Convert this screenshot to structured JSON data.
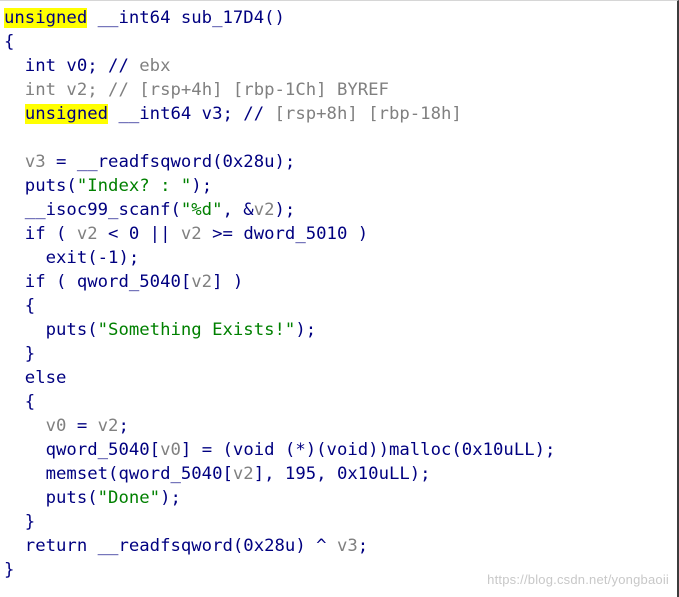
{
  "code_view": {
    "lines": [
      [
        {
          "text": "unsigned",
          "cls": "hl"
        },
        {
          "text": " __int64 sub_17D4()",
          "cls": "c"
        }
      ],
      [
        {
          "text": "{",
          "cls": "c"
        }
      ],
      [
        {
          "text": "  int v0; // ",
          "cls": "c"
        },
        {
          "text": "ebx",
          "cls": "gr"
        }
      ],
      [
        {
          "text": "  int v2; // ",
          "cls": "gr"
        },
        {
          "text": "[rsp+4h] [rbp-1Ch] BYREF",
          "cls": "gr"
        }
      ],
      [
        {
          "text": "  ",
          "cls": "c"
        },
        {
          "text": "unsigned",
          "cls": "hl"
        },
        {
          "text": " __int64 v3; // ",
          "cls": "c"
        },
        {
          "text": "[rsp+8h] [rbp-18h]",
          "cls": "gr"
        }
      ],
      [
        {
          "text": "",
          "cls": "c"
        }
      ],
      [
        {
          "text": "  ",
          "cls": "c"
        },
        {
          "text": "v3",
          "cls": "gr"
        },
        {
          "text": " = __readfsqword(0x28u);",
          "cls": "c"
        }
      ],
      [
        {
          "text": "  puts(",
          "cls": "c"
        },
        {
          "text": "\"Index? : \"",
          "cls": "sg"
        },
        {
          "text": ");",
          "cls": "c"
        }
      ],
      [
        {
          "text": "  __isoc99_scanf(",
          "cls": "c"
        },
        {
          "text": "\"%d\"",
          "cls": "sg"
        },
        {
          "text": ", &",
          "cls": "c"
        },
        {
          "text": "v2",
          "cls": "gr"
        },
        {
          "text": ");",
          "cls": "c"
        }
      ],
      [
        {
          "text": "  if ( ",
          "cls": "c"
        },
        {
          "text": "v2",
          "cls": "gr"
        },
        {
          "text": " < 0 || ",
          "cls": "c"
        },
        {
          "text": "v2",
          "cls": "gr"
        },
        {
          "text": " >= dword_5010 )",
          "cls": "c"
        }
      ],
      [
        {
          "text": "    exit(-1);",
          "cls": "c"
        }
      ],
      [
        {
          "text": "  if ( qword_5040[",
          "cls": "c"
        },
        {
          "text": "v2",
          "cls": "gr"
        },
        {
          "text": "] )",
          "cls": "c"
        }
      ],
      [
        {
          "text": "  {",
          "cls": "c"
        }
      ],
      [
        {
          "text": "    puts(",
          "cls": "c"
        },
        {
          "text": "\"Something Exists!\"",
          "cls": "sg"
        },
        {
          "text": ");",
          "cls": "c"
        }
      ],
      [
        {
          "text": "  }",
          "cls": "c"
        }
      ],
      [
        {
          "text": "  else",
          "cls": "c"
        }
      ],
      [
        {
          "text": "  {",
          "cls": "c"
        }
      ],
      [
        {
          "text": "    ",
          "cls": "c"
        },
        {
          "text": "v0",
          "cls": "gr"
        },
        {
          "text": " = ",
          "cls": "c"
        },
        {
          "text": "v2",
          "cls": "gr"
        },
        {
          "text": ";",
          "cls": "c"
        }
      ],
      [
        {
          "text": "    qword_5040[",
          "cls": "c"
        },
        {
          "text": "v0",
          "cls": "gr"
        },
        {
          "text": "] = (void (*)(void))malloc(0x10uLL);",
          "cls": "c"
        }
      ],
      [
        {
          "text": "    memset(qword_5040[",
          "cls": "c"
        },
        {
          "text": "v2",
          "cls": "gr"
        },
        {
          "text": "], 195, 0x10uLL);",
          "cls": "c"
        }
      ],
      [
        {
          "text": "    puts(",
          "cls": "c"
        },
        {
          "text": "\"Done\"",
          "cls": "sg"
        },
        {
          "text": ");",
          "cls": "c"
        }
      ],
      [
        {
          "text": "  }",
          "cls": "c"
        }
      ],
      [
        {
          "text": "  return __readfsqword(0x28u) ^ ",
          "cls": "c"
        },
        {
          "text": "v3",
          "cls": "gr"
        },
        {
          "text": ";",
          "cls": "c"
        }
      ],
      [
        {
          "text": "}",
          "cls": "c"
        }
      ]
    ]
  },
  "watermark": "https://blog.csdn.net/yongbaoii"
}
